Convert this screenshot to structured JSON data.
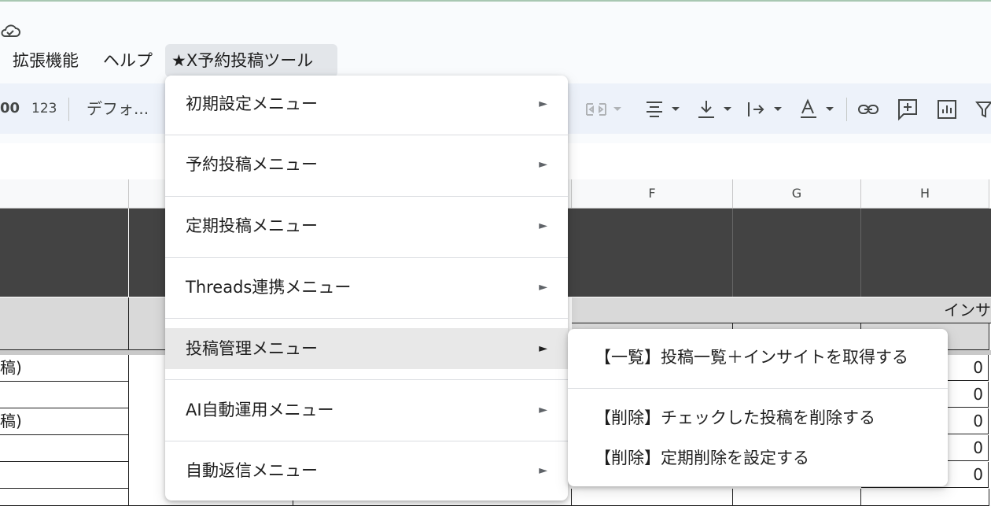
{
  "menubar": {
    "items": [
      {
        "label": "拡張機能"
      },
      {
        "label": "ヘルプ"
      },
      {
        "label": "★X予約投稿ツール"
      }
    ]
  },
  "toolbar": {
    "format_00": "00",
    "format_123": "123",
    "font": "デフォ..."
  },
  "grid": {
    "columns": [
      "F",
      "G",
      "H"
    ],
    "header_text": "インサ",
    "row_labels": [
      "稿)",
      "",
      "稿)",
      "",
      ""
    ],
    "h_values": [
      "0",
      "0",
      "0",
      "0",
      "0"
    ]
  },
  "menu": {
    "items": [
      {
        "label": "初期設定メニュー",
        "arrow": "►"
      },
      {
        "label": "予約投稿メニュー",
        "arrow": "►"
      },
      {
        "label": "定期投稿メニュー",
        "arrow": "►"
      },
      {
        "label": "Threads連携メニュー",
        "arrow": "►"
      },
      {
        "label": "投稿管理メニュー",
        "arrow": "►"
      },
      {
        "label": "AI自動運用メニュー",
        "arrow": "►"
      },
      {
        "label": "自動返信メニュー",
        "arrow": "►"
      }
    ]
  },
  "submenu": {
    "items": [
      {
        "label": "【一覧】投稿一覧＋インサイトを取得する"
      },
      {
        "label": "【削除】チェックした投稿を削除する"
      },
      {
        "label": "【削除】定期削除を設定する"
      }
    ]
  },
  "icons": {
    "cloud": "cloud-saved-icon",
    "align": "align-center-icon",
    "valign": "vertical-align-bottom-icon",
    "wrap": "text-wrap-icon",
    "rotate": "text-rotate-icon",
    "link": "insert-link-icon",
    "comment": "insert-comment-icon",
    "chart": "insert-chart-icon",
    "filter": "filter-icon",
    "merge": "merge-cells-icon"
  }
}
